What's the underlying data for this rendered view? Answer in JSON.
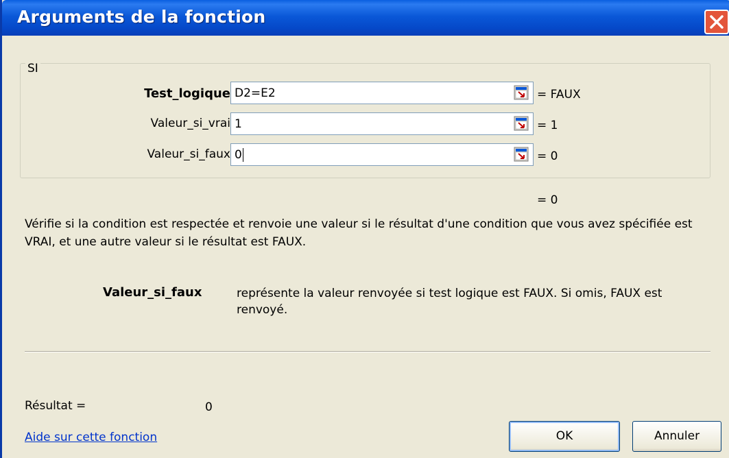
{
  "window": {
    "title": "Arguments de la fonction"
  },
  "function_group": {
    "name": "SI",
    "arguments": [
      {
        "label": "Test_logique",
        "value": "D2=E2",
        "evaluation": "= FAUX",
        "bold": true
      },
      {
        "label": "Valeur_si_vrai",
        "value": "1",
        "evaluation": "= 1",
        "bold": false
      },
      {
        "label": "Valeur_si_faux",
        "value": "0",
        "evaluation": "= 0",
        "bold": false
      }
    ]
  },
  "overall_result": "= 0",
  "description": "Vérifie si la condition est respectée et renvoie une valeur si le résultat d'une condition que vous avez spécifiée est VRAI, et une autre valeur si le résultat est FAUX.",
  "parameter_help": {
    "name": "Valeur_si_faux",
    "text": "représente la valeur renvoyée si test logique est FAUX. Si omis, FAUX est renvoyé."
  },
  "result": {
    "label": "Résultat =",
    "value": "0"
  },
  "help_link": "Aide sur cette fonction",
  "buttons": {
    "ok": "OK",
    "cancel": "Annuler"
  },
  "colors": {
    "titlebar": "#0a58d8",
    "dialog_bg": "#ece9d8",
    "close_button": "#e3553a",
    "link": "#0033cc"
  }
}
